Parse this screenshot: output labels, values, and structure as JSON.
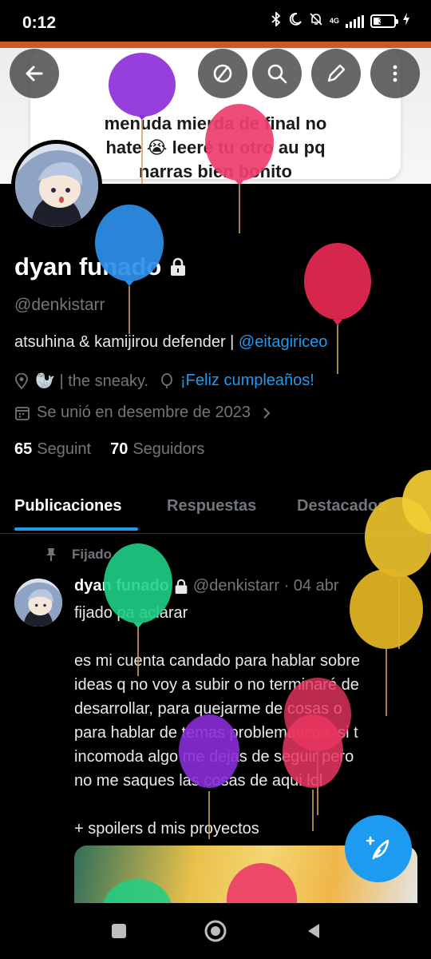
{
  "status_bar": {
    "time": "0:12",
    "network": "4G",
    "battery": "37",
    "battery_level": 0.37
  },
  "banner": {
    "tweet_text_line1": "menuda mierda de final no",
    "tweet_text_line2": "hate 😭 leeré tu otro au pq",
    "tweet_text_line3": "narras bien bonito"
  },
  "toolbar": {
    "back_icon": "arrow-left-icon",
    "mute_icon": "no-eye-icon",
    "search_icon": "search-icon",
    "edit_icon": "pencil-icon",
    "more_icon": "more-vertical-icon"
  },
  "profile": {
    "display_name": "dyan funado",
    "handle": "@denkistarr",
    "bio_text": "atsuhina & kamijirou defender | ",
    "bio_link": "@eitagiriceo",
    "location": "🦭 | the sneaky.",
    "birthday": "¡Feliz cumpleaños!",
    "joined": "Se unió en desembre de 2023",
    "following_count": "65",
    "following_label": "Seguint",
    "followers_count": "70",
    "followers_label": "Seguidors"
  },
  "tabs": [
    "Publicaciones",
    "Respuestas",
    "Destacados"
  ],
  "post": {
    "pinned_label": "Fijado",
    "author": "dyan funado",
    "handle_date": "@denkistarr · 04 abr",
    "body": "fijado pa aclarar\n\nes mi cuenta candado para hablar sobre\nideas q no voy a subir o no terminaré de\ndesarrollar, para quejarme de cosas o\npara hablar de temas problemáticos. si t\nincomoda algo me dejas de seguir pero\nno me saques las cosas de aqui lol\n\n+ spoilers d mis proyectos"
  },
  "colors": {
    "accent": "#1d9bf0",
    "background": "#000000",
    "muted": "#71767b",
    "text": "#e7e9ea"
  }
}
